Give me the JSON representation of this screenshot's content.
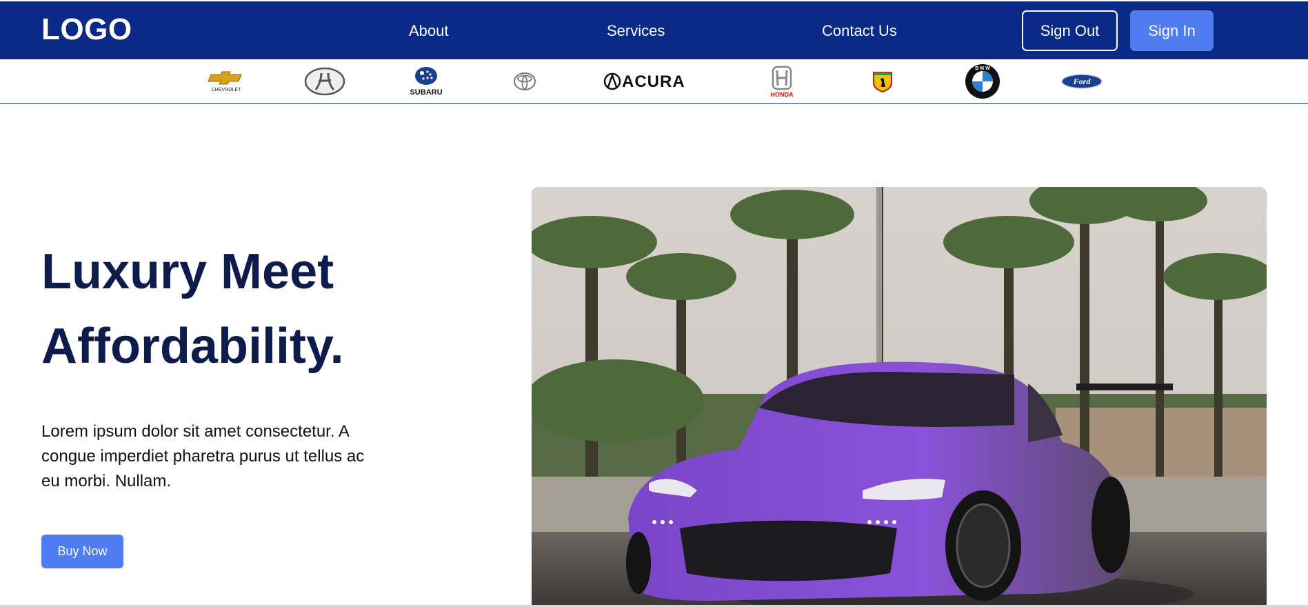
{
  "header": {
    "logo": "LOGO",
    "nav": [
      "About",
      "Services",
      "Contact Us"
    ],
    "sign_out": "Sign Out",
    "sign_in": "Sign In"
  },
  "brands": [
    {
      "name": "chevrolet-logo",
      "label": "CHEVROLET"
    },
    {
      "name": "hyundai-logo",
      "label": ""
    },
    {
      "name": "subaru-logo",
      "label": "SUBARU"
    },
    {
      "name": "toyota-logo",
      "label": ""
    },
    {
      "name": "acura-logo",
      "label": "ACURA"
    },
    {
      "name": "honda-logo",
      "label": "HONDA"
    },
    {
      "name": "ferrari-logo",
      "label": ""
    },
    {
      "name": "bmw-logo",
      "label": "B M W"
    },
    {
      "name": "ford-logo",
      "label": "Ford"
    }
  ],
  "hero": {
    "title_line1": "Luxury Meet",
    "title_line2": "Affordability.",
    "text": "Lorem ipsum dolor sit amet consectetur. A congue imperdiet pharetra purus ut tellus ac eu morbi. Nullam.",
    "buy_button": "Buy Now"
  },
  "colors": {
    "header_bg": "#0b2a88",
    "accent": "#4f7cf0",
    "title": "#0e1b4d"
  }
}
